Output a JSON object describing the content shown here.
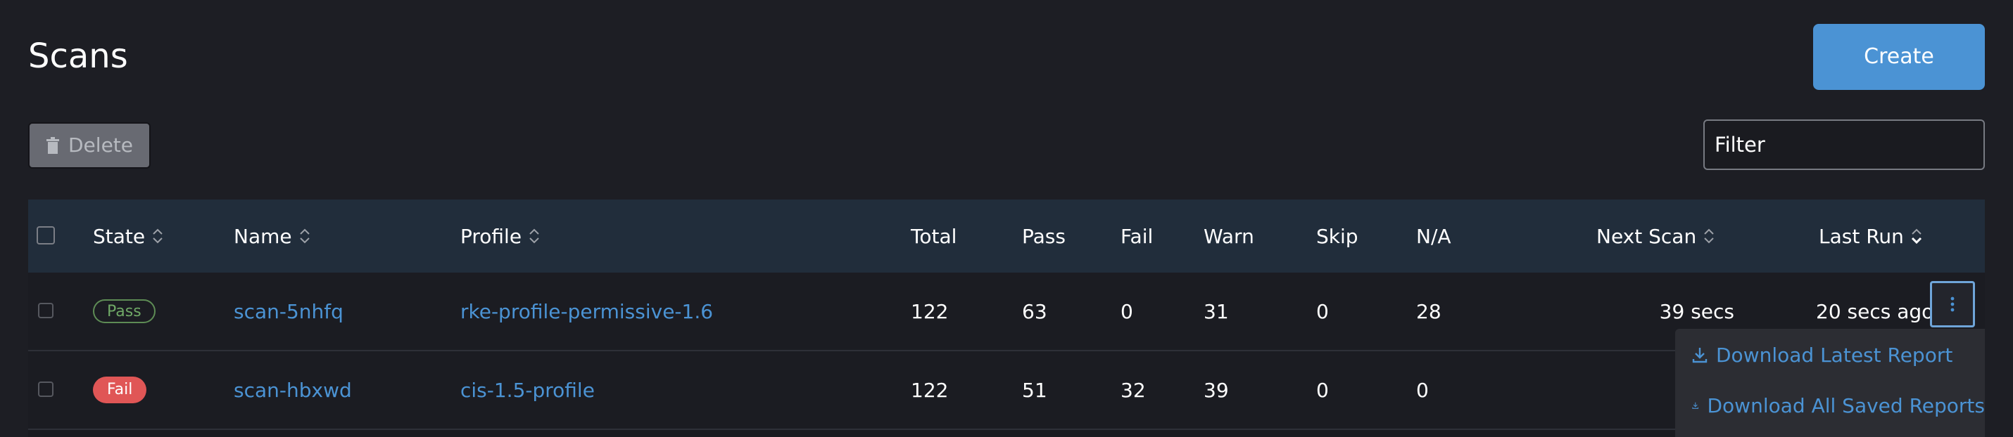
{
  "page": {
    "title": "Scans"
  },
  "toolbar": {
    "create_label": "Create",
    "delete_label": "Delete",
    "filter_placeholder": "Filter"
  },
  "table": {
    "columns": {
      "state": "State",
      "name": "Name",
      "profile": "Profile",
      "total": "Total",
      "pass": "Pass",
      "fail": "Fail",
      "warn": "Warn",
      "skip": "Skip",
      "na": "N/A",
      "next_scan": "Next Scan",
      "last_run": "Last Run"
    },
    "rows": [
      {
        "state": "Pass",
        "name": "scan-5nhfq",
        "profile": "rke-profile-permissive-1.6",
        "total": "122",
        "pass": "63",
        "fail": "0",
        "warn": "31",
        "skip": "0",
        "na": "28",
        "next_scan": "39 secs",
        "last_run": "20 secs ago"
      },
      {
        "state": "Fail",
        "name": "scan-hbxwd",
        "profile": "cis-1.5-profile",
        "total": "122",
        "pass": "51",
        "fail": "32",
        "warn": "39",
        "skip": "0",
        "na": "0",
        "next_scan": "",
        "last_run": ""
      }
    ]
  },
  "row_menu": {
    "items": [
      {
        "label": "Download Latest Report",
        "icon": "download-icon"
      },
      {
        "label": "Download All Saved Reports",
        "icon": "download-icon"
      }
    ]
  },
  "colors": {
    "background": "#1d1e24",
    "accent": "#4b93d4",
    "header": "#212d3b",
    "pass": "#6fa866",
    "fail": "#e05656"
  }
}
